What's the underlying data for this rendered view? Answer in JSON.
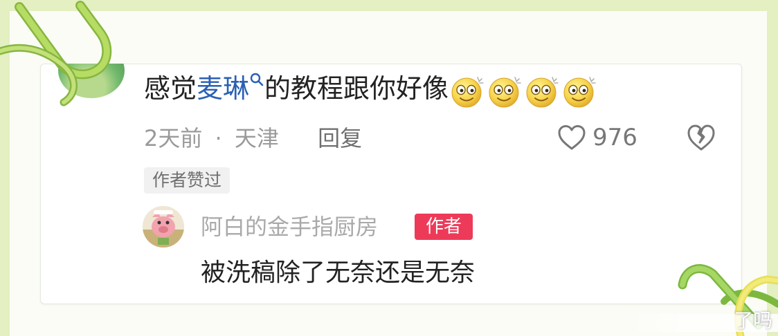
{
  "comment": {
    "text_before": "感觉",
    "link_text": "麦琳",
    "text_after": "的教程跟你好像",
    "emoji_count": 4,
    "time": "2天前",
    "separator": "·",
    "location": "天津",
    "reply_label": "回复",
    "like_count": "976",
    "author_liked_badge": "作者赞过"
  },
  "reply": {
    "username": "阿白的金手指厨房",
    "author_tag": "作者",
    "text": "被洗稿除了无奈还是无奈"
  },
  "watermark": {
    "text": "了吗"
  },
  "colors": {
    "link": "#2a5fb5",
    "author_tag_bg": "#ee3a59",
    "background": "#e4efc2",
    "paperclip_green": "#a7cf4c"
  },
  "icons": [
    "search-icon",
    "heart-icon",
    "dislike-icon",
    "smile-emoji",
    "paperclip-decoration"
  ]
}
